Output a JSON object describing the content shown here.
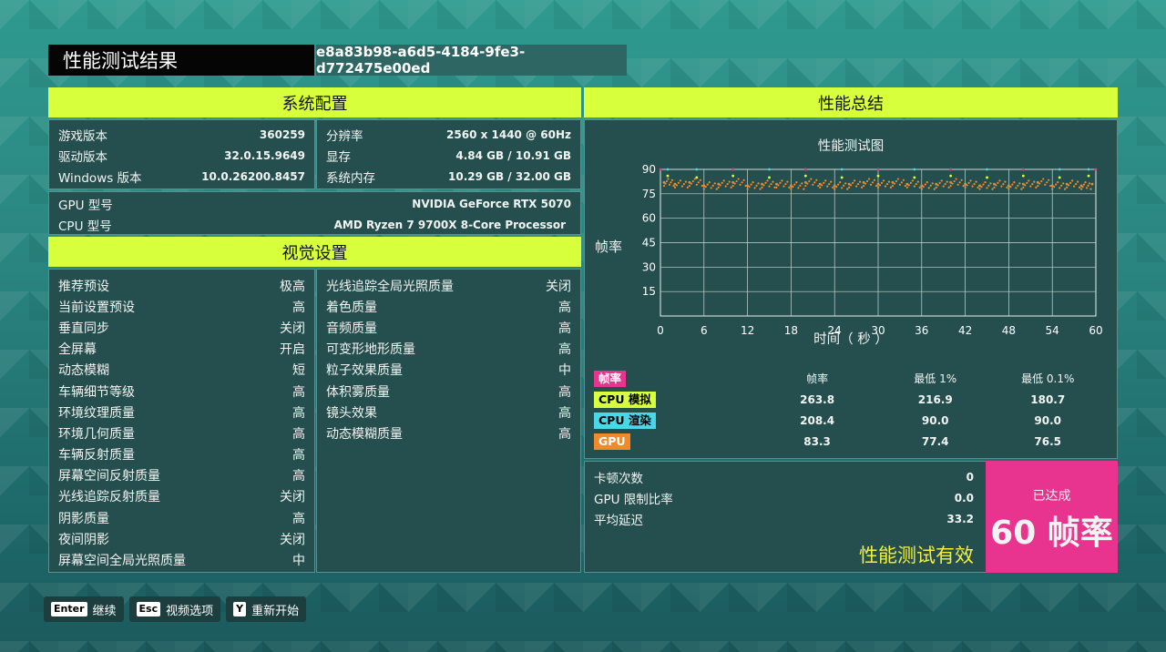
{
  "header": {
    "title": "性能测试结果",
    "run_id": "e8a83b98-a6d5-4184-9fe3-d772475e00ed"
  },
  "system_config": {
    "heading": "系统配置",
    "left": [
      {
        "label": "游戏版本",
        "value": "360259"
      },
      {
        "label": "驱动版本",
        "value": "32.0.15.9649"
      },
      {
        "label": "Windows 版本",
        "value": "10.0.26200.8457"
      }
    ],
    "right": [
      {
        "label": "分辨率",
        "value": "2560 x 1440 @ 60Hz"
      },
      {
        "label": "显存",
        "value": "4.84 GB / 10.91 GB"
      },
      {
        "label": "系统内存",
        "value": "10.29 GB / 32.00 GB"
      }
    ],
    "gpu": {
      "label": "GPU 型号",
      "value": "NVIDIA GeForce RTX 5070"
    },
    "cpu": {
      "label": "CPU 型号",
      "value": "AMD Ryzen 7 9700X 8-Core Processor"
    }
  },
  "visual_settings": {
    "heading": "视觉设置",
    "left": [
      {
        "label": "推荐预设",
        "value": "极高"
      },
      {
        "label": "当前设置预设",
        "value": "高"
      },
      {
        "label": "垂直同步",
        "value": "关闭"
      },
      {
        "label": "全屏幕",
        "value": "开启"
      },
      {
        "label": "动态模糊",
        "value": "短"
      },
      {
        "label": "车辆细节等级",
        "value": "高"
      },
      {
        "label": "环境纹理质量",
        "value": "高"
      },
      {
        "label": "环境几何质量",
        "value": "高"
      },
      {
        "label": "车辆反射质量",
        "value": "高"
      },
      {
        "label": "屏幕空间反射质量",
        "value": "高"
      },
      {
        "label": "光线追踪反射质量",
        "value": "关闭"
      },
      {
        "label": "阴影质量",
        "value": "高"
      },
      {
        "label": "夜间阴影",
        "value": "关闭"
      },
      {
        "label": "屏幕空间全局光照质量",
        "value": "中"
      }
    ],
    "right": [
      {
        "label": "光线追踪全局光照质量",
        "value": "关闭"
      },
      {
        "label": "着色质量",
        "value": "高"
      },
      {
        "label": "音频质量",
        "value": "高"
      },
      {
        "label": "可变形地形质量",
        "value": "高"
      },
      {
        "label": "粒子效果质量",
        "value": "中"
      },
      {
        "label": "体积雾质量",
        "value": "高"
      },
      {
        "label": "镜头效果",
        "value": "高"
      },
      {
        "label": "动态模糊质量",
        "value": "高"
      }
    ]
  },
  "performance": {
    "heading": "性能总结",
    "chart_title": "性能测试图",
    "y_label": "帧率",
    "x_label": "时间（ 秒 ）",
    "table_headers": [
      "帧率",
      "最低 1%",
      "最低 0.1%"
    ],
    "rows": [
      {
        "name": "帧率",
        "color": "#e8338f",
        "text_color": "#ffffff",
        "avg": "",
        "low1": "",
        "low01": ""
      },
      {
        "name": "CPU 模拟",
        "color": "#d8ff3c",
        "text_color": "#000000",
        "avg": "263.8",
        "low1": "216.9",
        "low01": "180.7"
      },
      {
        "name": "CPU 渲染",
        "color": "#4ad7e8",
        "text_color": "#000000",
        "avg": "208.4",
        "low1": "90.0",
        "low01": "90.0"
      },
      {
        "name": "GPU",
        "color": "#f08a2c",
        "text_color": "#ffffff",
        "avg": "83.3",
        "low1": "77.4",
        "low01": "76.5"
      }
    ],
    "stutter": {
      "label": "卡顿次数",
      "value": "0"
    },
    "gpu_limit": {
      "label": "GPU 限制比率",
      "value": "0.0"
    },
    "latency": {
      "label": "平均延迟",
      "value": "33.2"
    },
    "valid_text": "性能测试有效",
    "achieved_label": "已达成",
    "achieved_value": "60 帧率",
    "colors": {
      "accent": "#d8ff3c",
      "pink": "#e8338f"
    }
  },
  "chart_data": {
    "type": "scatter",
    "title": "性能测试图",
    "xlabel": "时间（ 秒 ）",
    "ylabel": "帧率",
    "xlim": [
      0,
      60
    ],
    "ylim": [
      0,
      90
    ],
    "xticks": [
      0,
      6,
      12,
      18,
      24,
      30,
      36,
      42,
      48,
      54,
      60
    ],
    "yticks": [
      15,
      30,
      45,
      60,
      75,
      90
    ],
    "grid": true,
    "series": [
      {
        "name": "GPU",
        "color": "#f08a2c",
        "x": [
          0.5,
          2,
          4,
          6,
          8,
          10,
          12,
          14,
          16,
          18,
          20,
          22,
          24,
          26,
          28,
          30,
          32,
          34,
          36,
          38,
          40,
          42,
          44,
          46,
          48,
          50,
          52,
          54,
          56,
          58,
          59.5
        ],
        "y": [
          82,
          81,
          82,
          80,
          81,
          82,
          80,
          81,
          81,
          80,
          82,
          81,
          80,
          81,
          82,
          81,
          82,
          81,
          80,
          81,
          82,
          81,
          80,
          81,
          80,
          81,
          82,
          80,
          81,
          80,
          81
        ]
      },
      {
        "name": "CPU 渲染",
        "color": "#4ad7e8",
        "x": [
          1,
          5,
          10,
          15,
          20,
          25,
          30,
          35,
          40,
          45,
          50,
          55,
          59
        ],
        "y": [
          90,
          90,
          90,
          90,
          90,
          90,
          90,
          90,
          90,
          90,
          90,
          90,
          90
        ]
      },
      {
        "name": "CPU 模拟",
        "color": "#d8ff3c",
        "x": [
          1,
          5,
          10,
          15,
          20,
          25,
          30,
          35,
          40,
          45,
          50,
          55,
          59
        ],
        "y": [
          86,
          85,
          86,
          85,
          86,
          85,
          86,
          85,
          86,
          85,
          86,
          85,
          86
        ]
      },
      {
        "name": "帧率",
        "color": "#e8338f",
        "x": [
          0,
          10,
          20,
          30,
          40,
          50,
          60
        ],
        "y": [
          90,
          90,
          90,
          90,
          90,
          90,
          90
        ]
      }
    ]
  },
  "footer": [
    {
      "key": "Enter",
      "label": "继续"
    },
    {
      "key": "Esc",
      "label": "视频选项"
    },
    {
      "key": "Y",
      "label": "重新开始"
    }
  ]
}
